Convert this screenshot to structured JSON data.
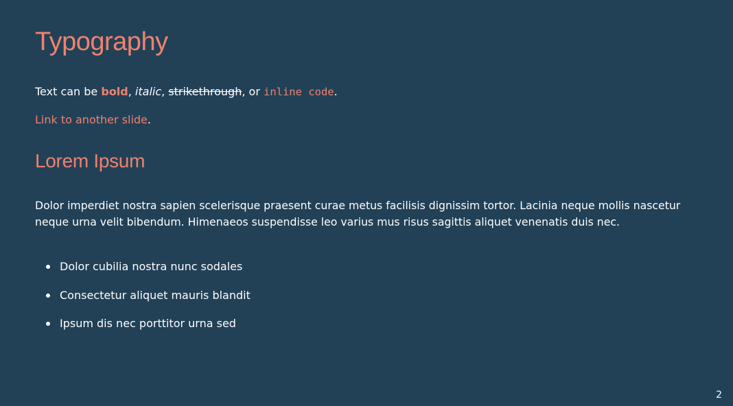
{
  "slide": {
    "title": "Typography",
    "intro": {
      "prefix": "Text can be ",
      "bold": "bold",
      "sep1": ", ",
      "italic": "italic",
      "sep2": ", ",
      "strike": "strikethrough",
      "sep3": ", or ",
      "code": "inline code",
      "suffix": "."
    },
    "link_line": {
      "link": "Link to another slide",
      "suffix": "."
    },
    "subtitle": "Lorem Ipsum",
    "paragraph": "Dolor imperdiet nostra sapien scelerisque praesent curae metus facilisis dignissim tortor. Lacinia neque mollis nascetur neque urna velit bibendum. Himenaeos suspendisse leo varius mus risus sagittis aliquet venenatis duis nec.",
    "bullets": [
      "Dolor cubilia nostra nunc sodales",
      "Consectetur aliquet mauris blandit",
      "Ipsum dis nec porttitor urna sed"
    ],
    "page_number": "2"
  },
  "colors": {
    "background": "#224157",
    "accent": "#f0826e",
    "text": "#ffffff"
  }
}
